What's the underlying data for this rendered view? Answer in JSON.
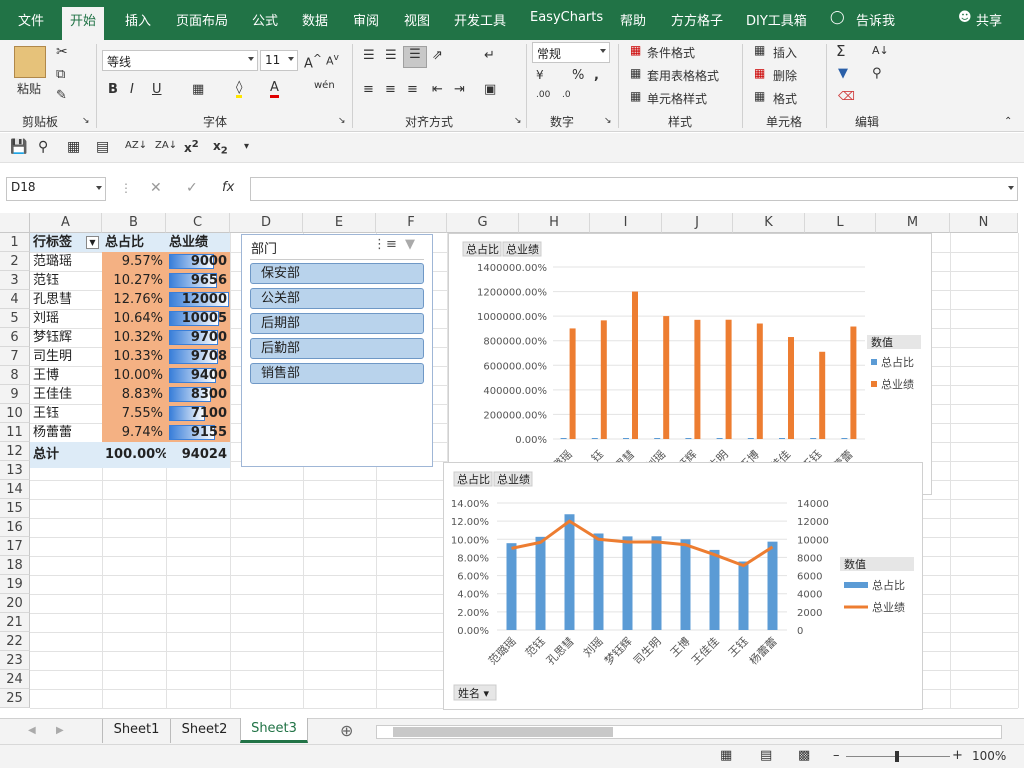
{
  "ribbon_tabs": [
    "文件",
    "开始",
    "插入",
    "页面布局",
    "公式",
    "数据",
    "审阅",
    "视图",
    "开发工具",
    "EasyCharts",
    "帮助",
    "方方格子",
    "DIY工具箱"
  ],
  "tellme": "告诉我",
  "share": "共享",
  "ribbon": {
    "clipboard": {
      "label": "剪贴板",
      "paste": "粘贴"
    },
    "font": {
      "label": "字体",
      "name": "等线",
      "size": "11"
    },
    "alignment": {
      "label": "对齐方式"
    },
    "number": {
      "label": "数字",
      "format": "常规"
    },
    "styles": {
      "label": "样式",
      "cond": "条件格式",
      "table": "套用表格格式",
      "cell": "单元格样式"
    },
    "cells": {
      "label": "单元格",
      "insert": "插入",
      "delete": "删除",
      "format": "格式"
    },
    "editing": {
      "label": "编辑"
    }
  },
  "formula_bar": {
    "namebox": "D18",
    "formula": ""
  },
  "columns": [
    "A",
    "B",
    "C",
    "D",
    "E",
    "F",
    "G",
    "H",
    "I",
    "J",
    "K",
    "L",
    "M",
    "N"
  ],
  "rows": [
    "1",
    "2",
    "3",
    "4",
    "5",
    "6",
    "7",
    "8",
    "9",
    "10",
    "11",
    "12",
    "13",
    "14",
    "15",
    "16",
    "17",
    "18",
    "19",
    "20",
    "21",
    "22",
    "23",
    "24",
    "25"
  ],
  "pivot": {
    "headers": [
      "行标签",
      "总占比",
      "总业绩"
    ],
    "names": [
      "范璐瑶",
      "范钰",
      "孔思彗",
      "刘瑶",
      "梦钰辉",
      "司生明",
      "王博",
      "王佳佳",
      "王钰",
      "杨蕾蕾"
    ],
    "pct": [
      "9.57%",
      "10.27%",
      "12.76%",
      "10.64%",
      "10.32%",
      "10.33%",
      "10.00%",
      "8.83%",
      "7.55%",
      "9.74%"
    ],
    "sales": [
      9000,
      9656,
      12000,
      10005,
      9700,
      9708,
      9400,
      8300,
      7100,
      9155
    ],
    "total_label": "总计",
    "total_pct": "100.00%",
    "total_sales": "94024"
  },
  "slicer": {
    "title": "部门",
    "items": [
      "保安部",
      "公关部",
      "后期部",
      "后勤部",
      "销售部"
    ]
  },
  "chart1": {
    "field_buttons": [
      "总占比",
      "总业绩"
    ],
    "legend_title": "数值",
    "legend": [
      "总占比",
      "总业绩"
    ],
    "y_ticks": [
      "1400000.00%",
      "1200000.00%",
      "1000000.00%",
      "800000.00%",
      "600000.00%",
      "400000.00%",
      "200000.00%",
      "0.00%"
    ],
    "x_labels": [
      "璐瑶",
      "钰",
      "思彗",
      "刘瑶",
      "钰辉",
      "生明",
      "王博",
      "佳佳",
      "王钰",
      "蕾蕾"
    ]
  },
  "chart2": {
    "field_buttons": [
      "总占比",
      "总业绩"
    ],
    "legend_title": "数值",
    "legend": [
      "总占比",
      "总业绩"
    ],
    "y_left": [
      "14.00%",
      "12.00%",
      "10.00%",
      "8.00%",
      "6.00%",
      "4.00%",
      "2.00%",
      "0.00%"
    ],
    "y_right": [
      "14000",
      "12000",
      "10000",
      "8000",
      "6000",
      "4000",
      "2000",
      "0"
    ],
    "axis_button": "姓名"
  },
  "chart_data": [
    {
      "type": "bar",
      "categories": [
        "范璐瑶",
        "范钰",
        "孔思彗",
        "刘瑶",
        "梦钰辉",
        "司生明",
        "王博",
        "王佳佳",
        "王钰",
        "杨蕾蕾"
      ],
      "series": [
        {
          "name": "总占比",
          "values": [
            9.57,
            10.27,
            12.76,
            10.64,
            10.32,
            10.33,
            10.0,
            8.83,
            7.55,
            9.74
          ]
        },
        {
          "name": "总业绩",
          "values": [
            900000,
            965600,
            1200000,
            1000500,
            970000,
            970800,
            940000,
            830000,
            710000,
            915500
          ]
        }
      ],
      "ylim": [
        0,
        1400000
      ],
      "legend": "right"
    },
    {
      "type": "bar",
      "categories": [
        "范璐瑶",
        "范钰",
        "孔思彗",
        "刘瑶",
        "梦钰辉",
        "司生明",
        "王博",
        "王佳佳",
        "王钰",
        "杨蕾蕾"
      ],
      "series": [
        {
          "name": "总占比",
          "values": [
            9.57,
            10.27,
            12.76,
            10.64,
            10.32,
            10.33,
            10.0,
            8.83,
            7.55,
            9.74
          ]
        },
        {
          "name": "总业绩",
          "values": [
            9000,
            9656,
            12000,
            10005,
            9700,
            9708,
            9400,
            8300,
            7100,
            9155
          ]
        }
      ],
      "ylim": [
        0,
        14
      ],
      "y2lim": [
        0,
        14000
      ],
      "legend": "right"
    }
  ],
  "colors": {
    "excel_green": "#217346",
    "bar_blue": "#5b9bd5",
    "bar_orange": "#ed7d31",
    "cell_fill": "#f4b183",
    "databar": "#3a7fd9"
  },
  "sheets": [
    "Sheet1",
    "Sheet2",
    "Sheet3"
  ],
  "active_sheet": "Sheet3",
  "zoom": "100%"
}
